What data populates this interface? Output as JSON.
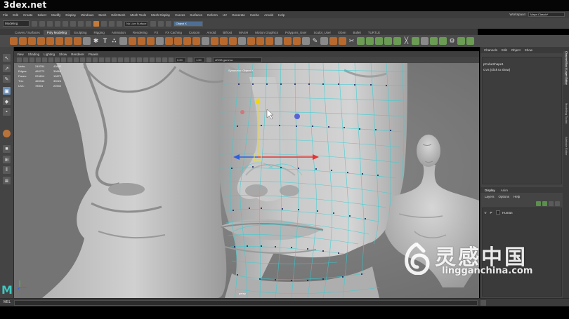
{
  "watermark_site": "3dex.net",
  "menu": [
    "File",
    "Edit",
    "Create",
    "Select",
    "Modify",
    "Display",
    "Windows",
    "Mesh",
    "Edit Mesh",
    "Mesh Tools",
    "Mesh Display",
    "Curves",
    "Surfaces",
    "Deform",
    "UV",
    "Generate",
    "Cache",
    "Arnold",
    "Help"
  ],
  "workspace": {
    "label": "Workspace:",
    "value": "Maya Classic*"
  },
  "status": {
    "mode": "Modeling",
    "live_surface": "No Live Surface",
    "symmetry_field": "Object X"
  },
  "shelf_tabs": [
    "Curves / Surfaces",
    "Poly Modeling",
    "Sculpting",
    "Rigging",
    "Animation",
    "Rendering",
    "FX",
    "FX Caching",
    "Custom",
    "Arnold",
    "Bifrost",
    "MASH",
    "Motion Graphics",
    "Polygons_User",
    "Sculpt_User",
    "XGen",
    "Bullet",
    "TURTLE"
  ],
  "active_shelf": 1,
  "panel_menu": [
    "View",
    "Shading",
    "Lighting",
    "Show",
    "Renderer",
    "Panels"
  ],
  "panel_fields": {
    "exposure": "0.00",
    "gamma": "1.00",
    "color_space": "sRGB gamma"
  },
  "hud": {
    "rows": [
      {
        "label": "Verts:",
        "a": "249794",
        "b": "40832"
      },
      {
        "label": "Edges:",
        "a": "469772",
        "b": "39664"
      },
      {
        "label": "Faces:",
        "a": "224814",
        "b": "19872"
      },
      {
        "label": "Tris:",
        "a": "469946",
        "b": "39024"
      },
      {
        "label": "UVs:",
        "a": "78904",
        "b": "20902"
      }
    ],
    "symmetry_label": "Symmetry: Object X",
    "camera": "persp"
  },
  "channel_box": {
    "tabs": [
      "Channels",
      "Edit",
      "Object",
      "Show"
    ],
    "shape_name": "pCubeShape1",
    "cvs_label": "CVs (click to show)"
  },
  "layer_editor": {
    "tabs": [
      "Display",
      "Anim"
    ],
    "menu": [
      "Layers",
      "Options",
      "Help"
    ],
    "layers": [
      {
        "v": "V",
        "p": "P",
        "name": "Human"
      }
    ]
  },
  "side_tabs": [
    "Channel Box / Layer Editor",
    "Modelling Toolkit",
    "Attribute Editor"
  ],
  "command_line": {
    "label": "MEL"
  },
  "watermark": {
    "cn": "灵感中国",
    "url": "lingganchina.com"
  },
  "colors": {
    "accent": "#4e6e93",
    "shelf_icon": "#b86a2e",
    "wire": "#2fd0d6",
    "maya_logo": "#3cc7c0"
  }
}
